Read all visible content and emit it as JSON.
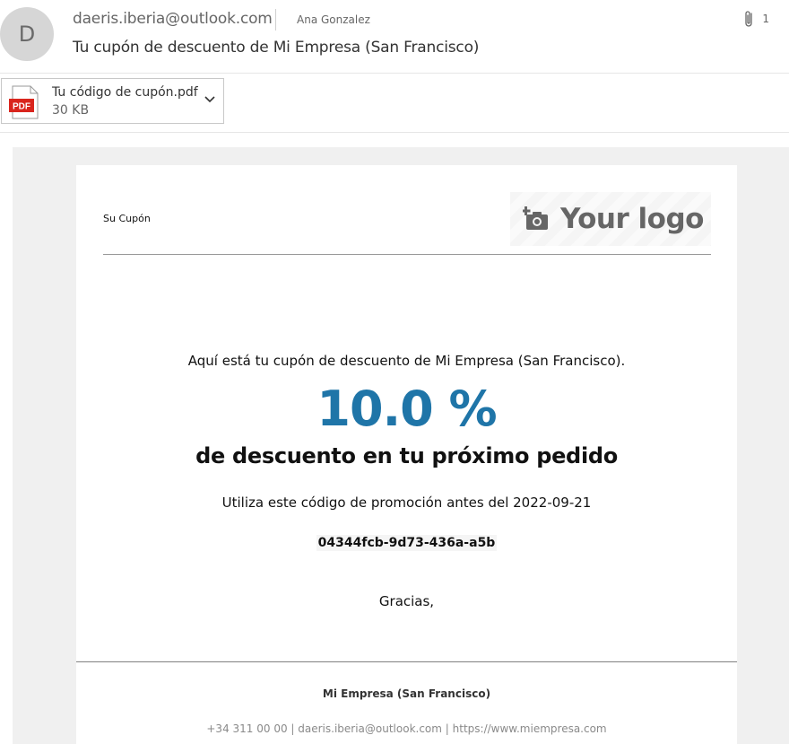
{
  "header": {
    "avatar_initial": "D",
    "from": "daeris.iberia@outlook.com",
    "to": "Ana Gonzalez",
    "subject": "Tu cupón de descuento de Mi Empresa (San Francisco)",
    "attachment_count": "1"
  },
  "attachment": {
    "icon_text": "PDF",
    "name": "Tu código de cupón.pdf",
    "size": "30 KB"
  },
  "email": {
    "label": "Su Cupón",
    "logo_text": "Your logo",
    "intro": "Aquí está tu cupón de descuento de Mi Empresa (San Francisco).",
    "discount": "10.0 %",
    "tagline": "de descuento en tu próximo pedido",
    "validity": "Utiliza este código de promoción antes del 2022-09-21",
    "code": "04344fcb-9d73-436a-a5b",
    "thanks": "Gracias,"
  },
  "footer": {
    "company": "Mi Empresa (San Francisco)",
    "contact": "+34 311 00 00 | daeris.iberia@outlook.com | https://www.miempresa.com"
  },
  "colors": {
    "accent": "#1f75a8",
    "pdf_red": "#d9251d"
  }
}
